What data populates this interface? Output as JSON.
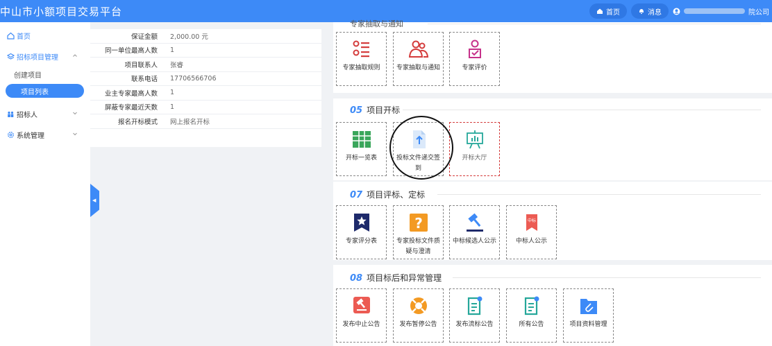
{
  "header": {
    "title": "中山市小额项目交易平台",
    "home_label": "首页",
    "message_label": "消息",
    "company_suffix": "院公司"
  },
  "sidebar": {
    "home": "首页",
    "bidding_project_mgmt": "招标项目管理",
    "create_project": "创建项目",
    "project_list": "项目列表",
    "bidder": "招标人",
    "system_mgmt": "系统管理"
  },
  "detail_rows": [
    {
      "key": "保证金额",
      "value": "2,000.00 元"
    },
    {
      "key": "同一单位最高人数",
      "value": "1"
    },
    {
      "key": "项目联系人",
      "value": "张睿"
    },
    {
      "key": "联系电话",
      "value": "17706566706"
    },
    {
      "key": "业主专家最高人数",
      "value": "1"
    },
    {
      "key": "屏蔽专家最近天数",
      "value": "1"
    },
    {
      "key": "报名开标模式",
      "value": "网上报名开标"
    }
  ],
  "sections": {
    "s04": {
      "title_partial": "专家抽取与通知",
      "cards": [
        "专家抽取规则",
        "专家抽取与通知",
        "专家评价"
      ]
    },
    "s05": {
      "num": "05",
      "title": "项目开标",
      "cards": [
        "开标一览表",
        "投标文件递交签到",
        "开标大厅"
      ]
    },
    "s07": {
      "num": "07",
      "title": "项目评标、定标",
      "cards": [
        "专家评分表",
        "专家投标文件质疑与澄清",
        "中标候选人公示",
        "中标人公示"
      ]
    },
    "s08": {
      "num": "08",
      "title": "项目标后和异常管理",
      "cards": [
        "发布中止公告",
        "发布暂停公告",
        "发布流标公告",
        "所有公告",
        "项目资料管理"
      ]
    }
  },
  "icons": {
    "badge_text": "中标",
    "colors": {
      "primary": "#3d8af7",
      "expert_red": "#d43c3c",
      "expert_pink": "#c6318a",
      "green": "#3aa65b",
      "navy": "#1e2a6b",
      "orange": "#f39a23",
      "teal": "#25a79a",
      "coral": "#ec5b53"
    }
  }
}
